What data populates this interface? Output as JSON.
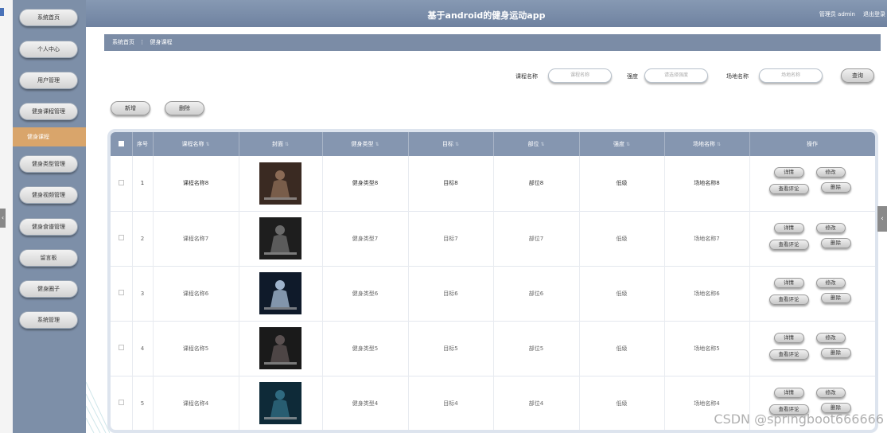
{
  "app": {
    "title": "基于android的健身运动app",
    "admin_label": "管理员 admin",
    "logout_label": "退出登录"
  },
  "sidebar": {
    "items": [
      {
        "label": "系统首页"
      },
      {
        "label": "个人中心"
      },
      {
        "label": "用户管理"
      },
      {
        "label": "健身课程管理"
      },
      {
        "label": "健身课程"
      },
      {
        "label": "健身类型管理"
      },
      {
        "label": "健身视频管理"
      },
      {
        "label": "健身食谱管理"
      },
      {
        "label": "留言板"
      },
      {
        "label": "健身圈子"
      },
      {
        "label": "系统管理"
      }
    ],
    "active_index": 4
  },
  "breadcrumb": {
    "home": "系统首页",
    "separator": "⋮",
    "current": "健身课程"
  },
  "search": {
    "course_label": "课程名称",
    "course_placeholder": "课程名称",
    "intensity_label": "强度",
    "intensity_placeholder": "请选择强度",
    "venue_label": "场地名称",
    "venue_placeholder": "场地名称",
    "query_button": "查询"
  },
  "toolbar": {
    "add_button": "新增",
    "delete_button": "删除"
  },
  "table": {
    "headers": {
      "index": "序号",
      "course_name": "课程名称",
      "cover": "封面",
      "type": "健身类型",
      "goal": "目标",
      "part": "部位",
      "intensity": "强度",
      "venue": "场地名称",
      "actions": "操作"
    },
    "rows": [
      {
        "index": "1",
        "course_name": "课程名称8",
        "type": "健身类型8",
        "goal": "目标8",
        "part": "部位8",
        "intensity": "低级",
        "venue": "场地名称8"
      },
      {
        "index": "2",
        "course_name": "课程名称7",
        "type": "健身类型7",
        "goal": "目标7",
        "part": "部位7",
        "intensity": "低级",
        "venue": "场地名称7"
      },
      {
        "index": "3",
        "course_name": "课程名称6",
        "type": "健身类型6",
        "goal": "目标6",
        "part": "部位6",
        "intensity": "低级",
        "venue": "场地名称6"
      },
      {
        "index": "4",
        "course_name": "课程名称5",
        "type": "健身类型5",
        "goal": "目标5",
        "part": "部位5",
        "intensity": "低级",
        "venue": "场地名称5"
      },
      {
        "index": "5",
        "course_name": "课程名称4",
        "type": "健身类型4",
        "goal": "目标4",
        "part": "部位4",
        "intensity": "低级",
        "venue": "场地名称4"
      }
    ],
    "row_actions": {
      "detail": "详情",
      "edit": "修改",
      "comments": "查看评论",
      "delete": "删除"
    }
  },
  "watermark": "CSDN @springboot666666",
  "colors": {
    "sidebar": "#7d8fa8",
    "active_item": "#d9a56b",
    "header": "#8596b0"
  }
}
